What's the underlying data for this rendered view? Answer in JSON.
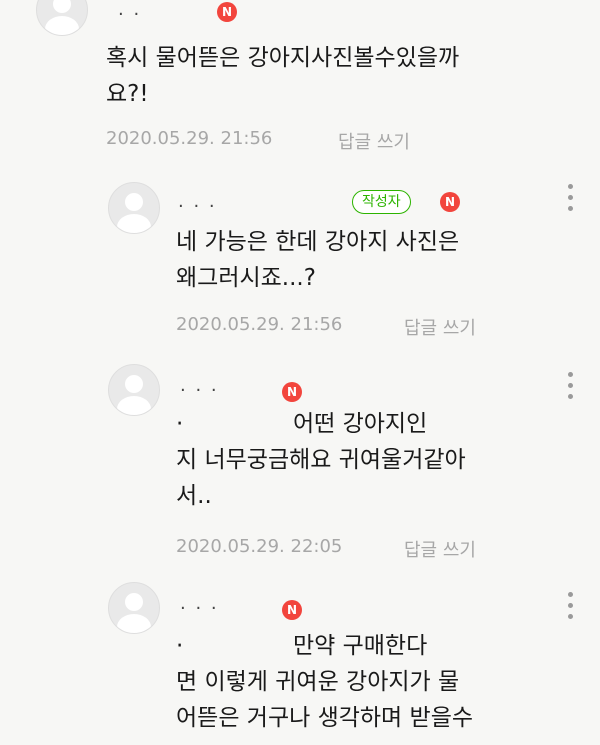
{
  "comments": [
    {
      "nickname": "·   ·",
      "badge": "N",
      "lines": "혹시 물어뜯은 강아지사진볼수있을까\n요?!",
      "date": "2020.05.29. 21:56",
      "reply_label": "답글 쓰기"
    },
    {
      "nickname": "·   ·   ·",
      "author_badge": "작성자",
      "badge": "N",
      "lines": "네 가능은 한데 강아지 사진은\n왜그러시죠...?",
      "date": "2020.05.29. 21:56",
      "reply_label": "답글 쓰기"
    },
    {
      "nickname": "·  ·  ·",
      "badge": "N",
      "lines": "·               어떤 강아지인\n지 너무궁금해요 귀여울거같아\n서..",
      "date": "2020.05.29. 22:05",
      "reply_label": "답글 쓰기"
    },
    {
      "nickname": "·  ·  ·",
      "badge": "N",
      "lines": "·               만약 구매한다\n면 이렇게 귀여운 강아지가 물\n어뜯은 거구나 생각하며 받을수",
      "date": "",
      "reply_label": ""
    }
  ]
}
